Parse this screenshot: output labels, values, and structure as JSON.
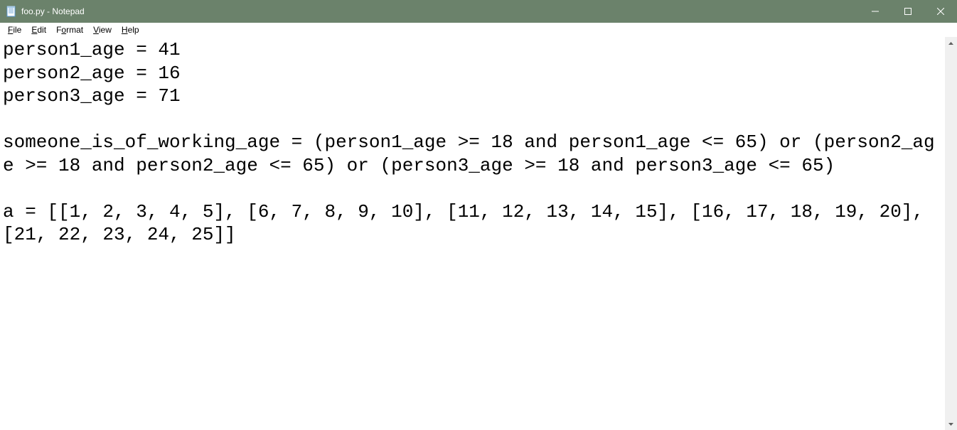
{
  "window": {
    "title": "foo.py - Notepad"
  },
  "menu": {
    "file": "File",
    "edit": "Edit",
    "format": "Format",
    "view": "View",
    "help": "Help"
  },
  "editor": {
    "content": "person1_age = 41\nperson2_age = 16\nperson3_age = 71\n\nsomeone_is_of_working_age = (person1_age >= 18 and person1_age <= 65) or (person2_age >= 18 and person2_age <= 65) or (person3_age >= 18 and person3_age <= 65)\n\na = [[1, 2, 3, 4, 5], [6, 7, 8, 9, 10], [11, 12, 13, 14, 15], [16, 17, 18, 19, 20], [21, 22, 23, 24, 25]]\n"
  }
}
